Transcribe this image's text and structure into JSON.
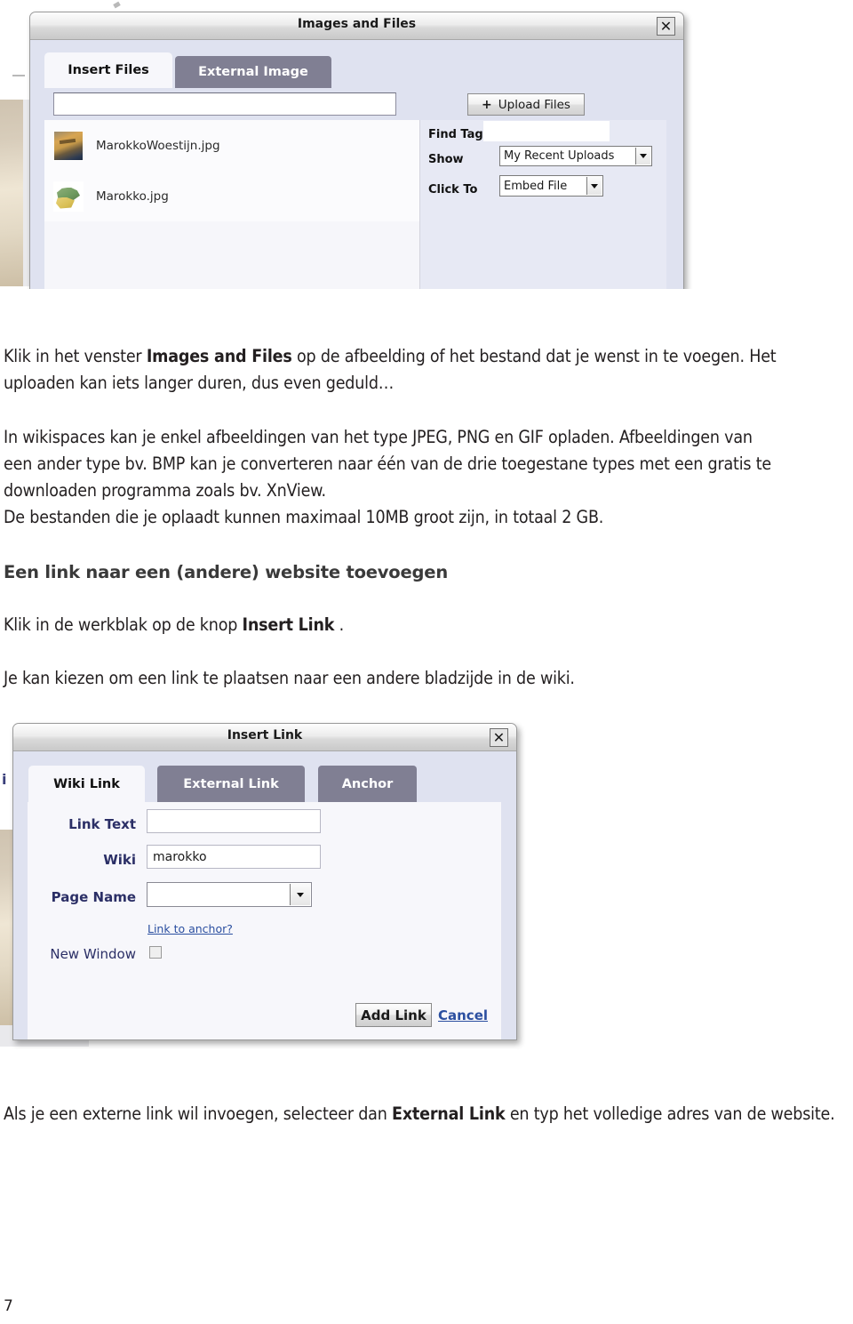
{
  "page": {
    "number": "7"
  },
  "screenshot_images": {
    "modal": {
      "title": "Images and Files",
      "close_icon": "close-icon",
      "tabs": [
        {
          "label": "Insert Files",
          "active": true
        },
        {
          "label": "External Image",
          "active": false
        }
      ],
      "search_value": "",
      "files": [
        {
          "name": "MarokkoWoestijn.jpg",
          "thumb": "desert-photo-thumbnail"
        },
        {
          "name": "Marokko.jpg",
          "thumb": "map-photo-thumbnail"
        }
      ],
      "upload_button": "Upload Files",
      "upload_icon": "plus-icon",
      "fields": [
        {
          "label": "Find Tag",
          "type": "text",
          "value": ""
        },
        {
          "label": "Show",
          "type": "select",
          "value": "My Recent Uploads"
        },
        {
          "label": "Click To",
          "type": "select",
          "value": "Embed File"
        }
      ]
    }
  },
  "body": {
    "para1": {
      "pre": "Klik in het venster ",
      "bold": "Images and Files",
      "post": " op de afbeelding of het bestand dat je wenst in te voegen. Het uploaden kan iets langer duren, dus even geduld…"
    },
    "para2": "In wikispaces kan je enkel afbeeldingen van het type JPEG, PNG en GIF opladen. Afbeeldingen van een ander type bv. BMP kan je converteren naar één van de drie toegestane types met een gratis te downloaden programma zoals bv. XnView.",
    "para3": "De bestanden die je oplaadt kunnen maximaal 10MB groot zijn, in totaal 2 GB.",
    "heading1": "Een link naar een (andere) website toevoegen",
    "para4": {
      "pre": "Klik in de werkblak op de knop ",
      "bold": "Insert Link",
      "post": " ."
    },
    "para5": "Je kan kiezen om een link te plaatsen naar een andere bladzijde in de wiki.",
    "para6": {
      "pre": "Als je een externe link wil invoegen, selecteer dan ",
      "bold": "External Link",
      "post": " en typ het volledige adres van de website."
    }
  },
  "screenshot_link": {
    "modal": {
      "title": "Insert Link",
      "close_icon": "close-icon",
      "tabs": [
        {
          "label": "Wiki Link",
          "active": true
        },
        {
          "label": "External Link",
          "active": false
        },
        {
          "label": "Anchor",
          "active": false
        }
      ],
      "fields": [
        {
          "label": "Link Text",
          "type": "text",
          "value": ""
        },
        {
          "label": "Wiki",
          "type": "text",
          "value": "marokko"
        },
        {
          "label": "Page Name",
          "type": "select",
          "value": ""
        }
      ],
      "anchor_link": "Link to anchor?",
      "new_window_label": "New Window",
      "new_window_checked": false,
      "add_button": "Add Link",
      "cancel_link": "Cancel"
    }
  },
  "colors": {
    "tab_inactive": "#807f93",
    "modal_body": "#dfe2f0",
    "panel": "#f7f7fb",
    "link_label": "#2b2f66",
    "link_blue": "#2b4fa0",
    "text": "#231f20"
  }
}
